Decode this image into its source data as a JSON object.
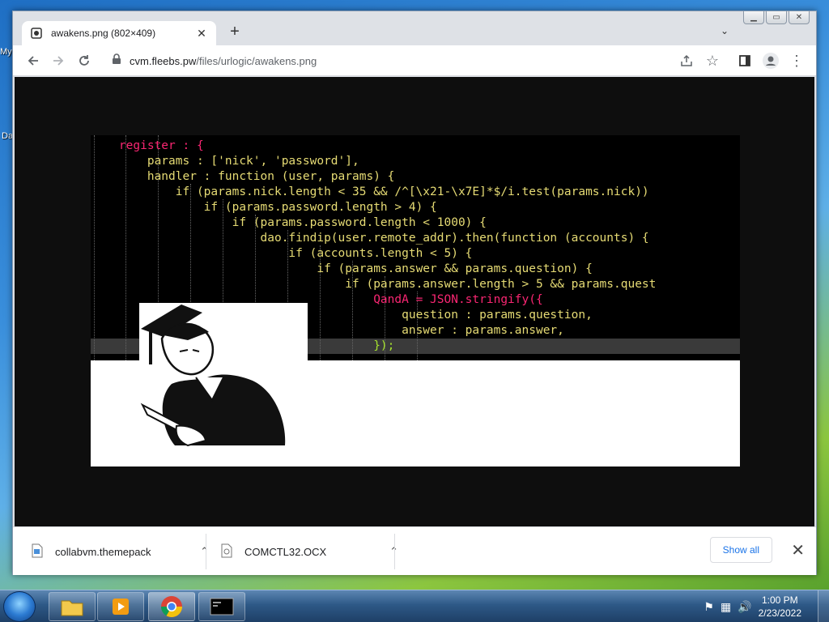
{
  "desktop": {
    "icon_label_1": "My",
    "icon_label_2": "Da"
  },
  "browser": {
    "tab": {
      "title": "awakens.png (802×409)",
      "favicon": "image-file-icon"
    },
    "address": {
      "domain": "cvm.fleebs.pw",
      "path": "/files/urlogic/awakens.png"
    },
    "toolbar_icons": [
      "back-icon",
      "forward-icon",
      "reload-icon",
      "share-icon",
      "star-icon",
      "side-panel-icon",
      "profile-icon",
      "menu-icon"
    ]
  },
  "image": {
    "code_lines": [
      "    register : {",
      "        params : ['nick', 'password'],",
      "        handler : function (user, params) {",
      "            if (params.nick.length < 35 && /^[\\x21-\\x7E]*$/i.test(params.nick))",
      "                if (params.password.length > 4) {",
      "                    if (params.password.length < 1000) {",
      "                        dao.findip(user.remote_addr).then(function (accounts) {",
      "                            if (accounts.length < 5) {",
      "                                if (params.answer && params.question) {",
      "                                    if (params.answer.length > 5 && params.quest",
      "                                        QandA = JSON.stringify({",
      "                                            question : params.question,",
      "                                            answer : params.answer,",
      "                                        });"
    ]
  },
  "downloads": {
    "items": [
      {
        "name": "collabvm.themepack"
      },
      {
        "name": "COMCTL32.OCX"
      }
    ],
    "show_all": "Show all"
  },
  "taskbar": {
    "time": "1:00 PM",
    "date": "2/23/2022"
  }
}
